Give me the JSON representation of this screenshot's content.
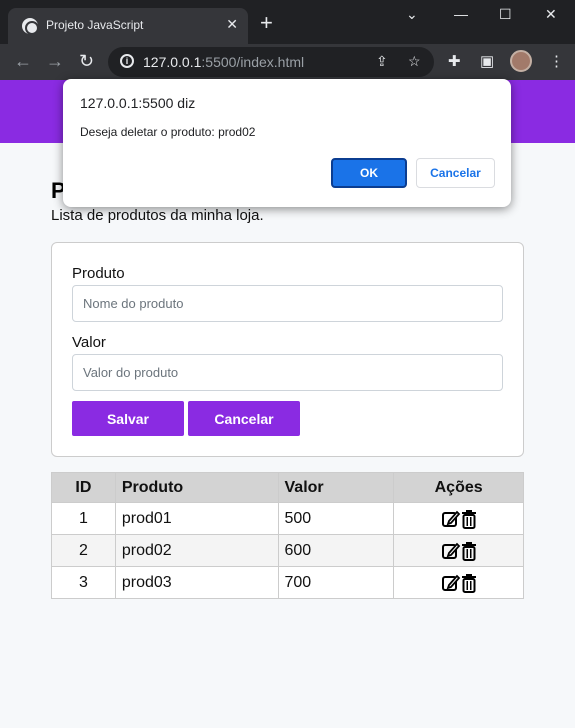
{
  "browser": {
    "tab_title": "Projeto JavaScript",
    "url_host": "127.0.0.1",
    "url_rest": ":5500/index.html"
  },
  "page": {
    "title": "P",
    "subtitle": "Lista de produtos da minha loja."
  },
  "form": {
    "product_label": "Produto",
    "product_placeholder": "Nome do produto",
    "value_label": "Valor",
    "value_placeholder": "Valor do produto",
    "save_label": "Salvar",
    "cancel_label": "Cancelar"
  },
  "table": {
    "headers": [
      "ID",
      "Produto",
      "Valor",
      "Ações"
    ],
    "rows": [
      {
        "id": "1",
        "product": "prod01",
        "value": "500"
      },
      {
        "id": "2",
        "product": "prod02",
        "value": "600"
      },
      {
        "id": "3",
        "product": "prod03",
        "value": "700"
      }
    ]
  },
  "dialog": {
    "title": "127.0.0.1:5500 diz",
    "message": "Deseja deletar o produto: prod02",
    "ok_label": "OK",
    "cancel_label": "Cancelar"
  },
  "colors": {
    "accent": "#8a2be2",
    "dialog_primary": "#1a73e8"
  }
}
